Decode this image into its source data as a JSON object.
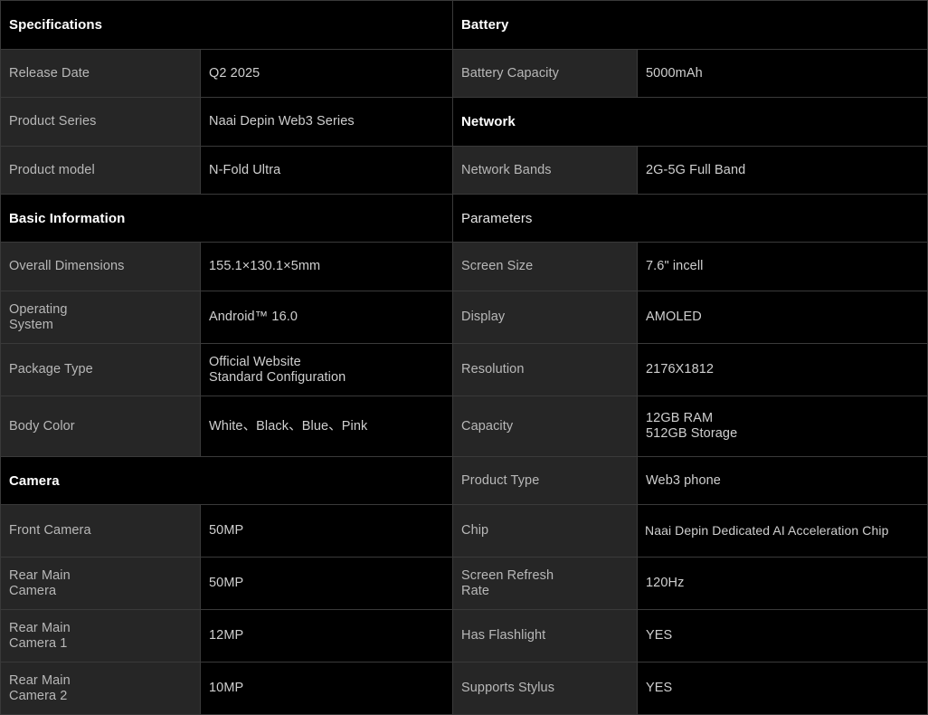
{
  "left": {
    "specifications_header": "Specifications",
    "release_date": {
      "label": "Release Date",
      "value": "Q2 2025"
    },
    "product_series": {
      "label": "Product Series",
      "value": "Naai Depin Web3 Series"
    },
    "product_model": {
      "label": "Product model",
      "value": "N-Fold Ultra"
    },
    "basic_info_header": "Basic Information",
    "overall_dimensions": {
      "label": "Overall Dimensions",
      "value": "155.1×130.1×5mm"
    },
    "operating_system": {
      "label": "Operating\nSystem",
      "value": "Android™  16.0"
    },
    "package_type": {
      "label": "Package Type",
      "value": "Official Website\nStandard Configuration"
    },
    "body_color": {
      "label": "Body Color",
      "value": "White、Black、Blue、Pink"
    },
    "camera_header": "Camera",
    "front_camera": {
      "label": "Front Camera",
      "value": "50MP"
    },
    "rear_main_camera": {
      "label": "Rear Main\nCamera",
      "value": "50MP"
    },
    "rear_main_camera_1": {
      "label": "Rear Main\nCamera 1",
      "value": "12MP"
    },
    "rear_main_camera_2": {
      "label": "Rear Main\nCamera 2",
      "value": "10MP"
    }
  },
  "right": {
    "battery_header": "Battery",
    "battery_capacity": {
      "label": "Battery Capacity",
      "value": "5000mAh"
    },
    "network_header": "Network",
    "network_bands": {
      "label": "Network Bands",
      "value": "2G-5G Full Band"
    },
    "parameters_header": "Parameters",
    "screen_size": {
      "label": "Screen Size",
      "value": "7.6\" incell"
    },
    "display": {
      "label": "Display",
      "value": "AMOLED"
    },
    "resolution": {
      "label": "Resolution",
      "value": "2176X1812"
    },
    "capacity": {
      "label": "Capacity",
      "value": "12GB RAM\n512GB Storage"
    },
    "product_type": {
      "label": "Product Type",
      "value": "Web3 phone"
    },
    "chip": {
      "label": "Chip",
      "value": "Naai Depin Dedicated AI Acceleration Chip"
    },
    "screen_refresh_rate": {
      "label": "Screen Refresh\nRate",
      "value": "120Hz"
    },
    "has_flashlight": {
      "label": "Has Flashlight",
      "value": "YES"
    },
    "supports_stylus": {
      "label": "Supports Stylus",
      "value": "YES"
    }
  }
}
